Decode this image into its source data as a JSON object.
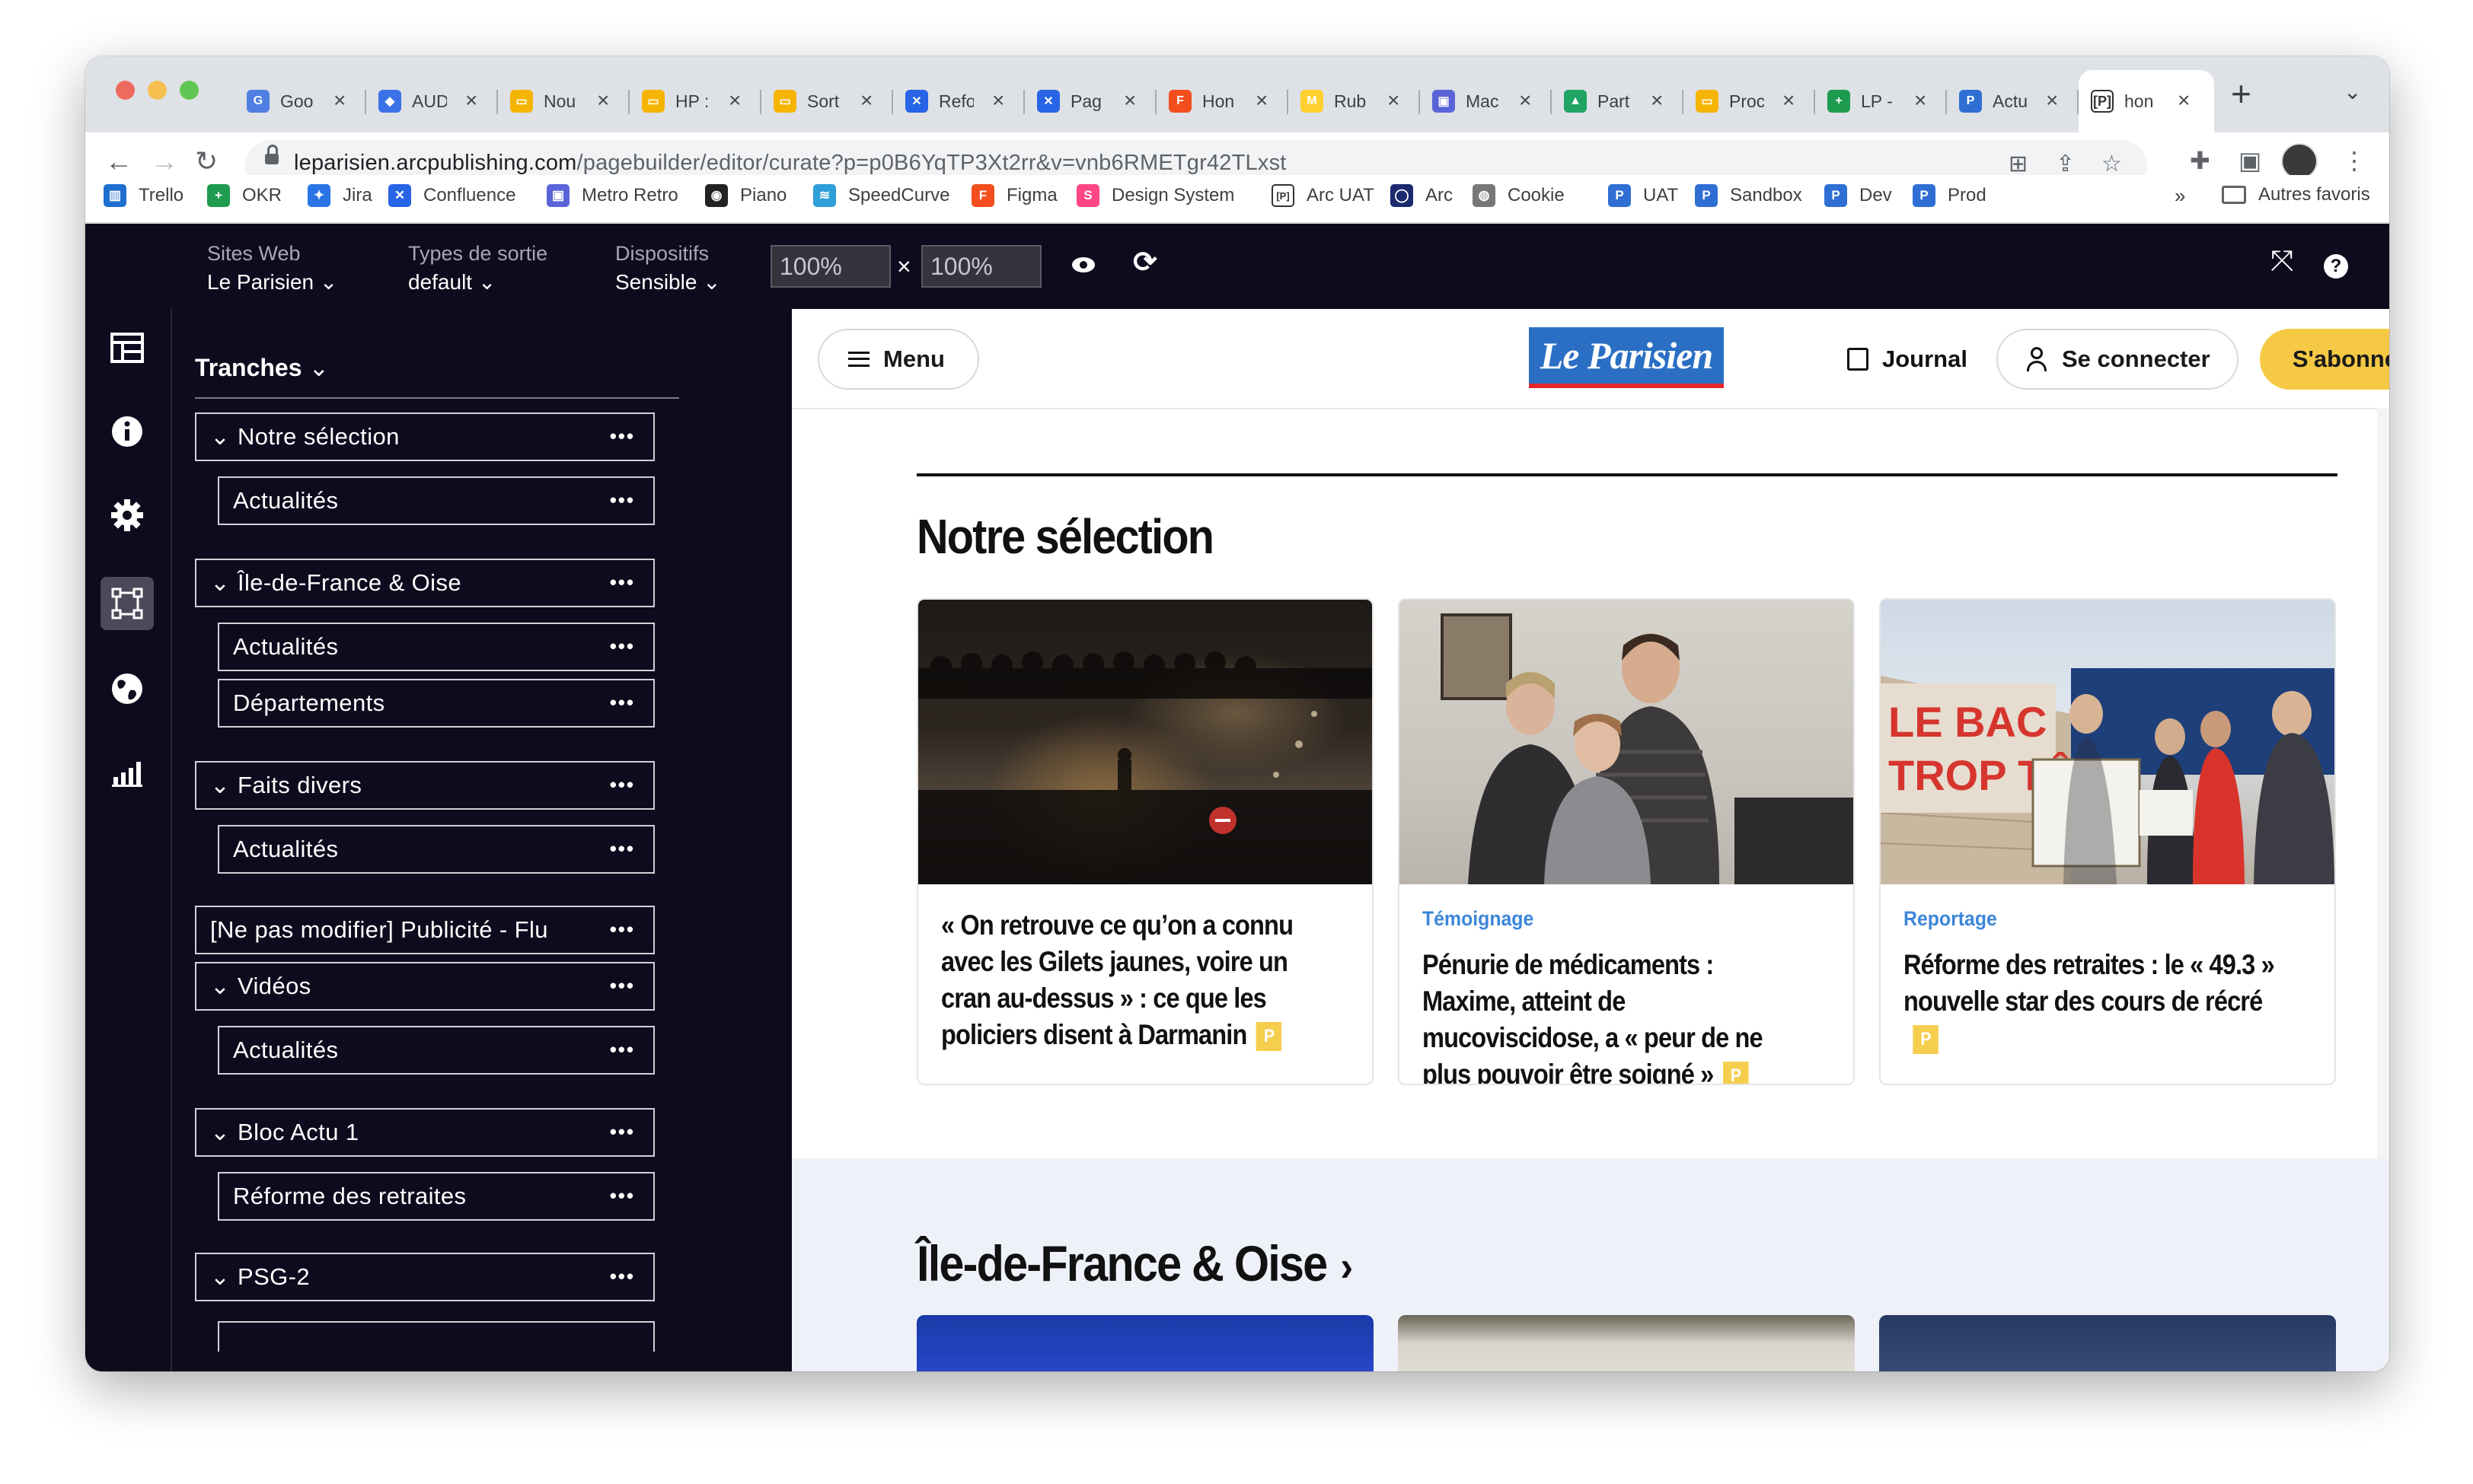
{
  "browser": {
    "traffic_lights": [
      "#ed6a5e",
      "#f4bf4f",
      "#61c554"
    ],
    "tabs": [
      {
        "title": "Goo",
        "icon": "google-docs-icon",
        "color": "#4f7fe0",
        "glyph": "G"
      },
      {
        "title": "AUD",
        "icon": "diamond-icon",
        "color": "#3b72e8",
        "glyph": "◆"
      },
      {
        "title": "Nou",
        "icon": "slides-icon",
        "color": "#f5b400",
        "glyph": "▭"
      },
      {
        "title": "HP :",
        "icon": "slides-icon",
        "color": "#f5b400",
        "glyph": "▭"
      },
      {
        "title": "Sort",
        "icon": "slides-icon",
        "color": "#f5b400",
        "glyph": "▭"
      },
      {
        "title": "Refo",
        "icon": "confluence-icon",
        "color": "#2764e6",
        "glyph": "✕"
      },
      {
        "title": "Pag",
        "icon": "confluence-icon",
        "color": "#2764e6",
        "glyph": "✕"
      },
      {
        "title": "Hon",
        "icon": "figma-icon",
        "color": "#f24e1e",
        "glyph": "F"
      },
      {
        "title": "Rub",
        "icon": "miro-icon",
        "color": "#ffd02f",
        "glyph": "M"
      },
      {
        "title": "Mac",
        "icon": "metro-retro-icon",
        "color": "#5a64d8",
        "glyph": "▣"
      },
      {
        "title": "Part",
        "icon": "google-drive-icon",
        "color": "#1fa463",
        "glyph": "▲"
      },
      {
        "title": "Proc",
        "icon": "slides-icon",
        "color": "#f5b400",
        "glyph": "▭"
      },
      {
        "title": "LP -",
        "icon": "sheets-icon",
        "color": "#1e9b4f",
        "glyph": "+"
      },
      {
        "title": "Actu",
        "icon": "p-icon",
        "color": "#2f6fd4",
        "glyph": "P"
      },
      {
        "title": "hon",
        "icon": "pb-icon",
        "color": "#555555",
        "glyph": "[P]"
      }
    ],
    "new_tab": "+",
    "tab_menu": "⌄",
    "url": {
      "host": "leparisien.arcpublishing.com",
      "path": "/pagebuilder/editor/curate?p=p0B6YqTP3Xt2rr&v=vnb6RMETgr42TLxst"
    },
    "bookmarks": [
      {
        "label": "Trello",
        "icon": "trello-icon",
        "color": "#1f6fd0",
        "glyph": "▥"
      },
      {
        "label": "OKR",
        "icon": "sheets-icon",
        "color": "#1e9b4f",
        "glyph": "+"
      },
      {
        "label": "Jira",
        "icon": "jira-icon",
        "color": "#2a74e6",
        "glyph": "✦"
      },
      {
        "label": "Confluence",
        "icon": "confluence-icon",
        "color": "#2764e6",
        "glyph": "✕"
      },
      {
        "label": "Metro Retro",
        "icon": "metro-retro-icon",
        "color": "#5a64d8",
        "glyph": "▣"
      },
      {
        "label": "Piano",
        "icon": "piano-icon",
        "color": "#222222",
        "glyph": "◉"
      },
      {
        "label": "SpeedCurve",
        "icon": "speedcurve-icon",
        "color": "#2e9fd8",
        "glyph": "≋"
      },
      {
        "label": "Figma",
        "icon": "figma-icon",
        "color": "#f24e1e",
        "glyph": "F"
      },
      {
        "label": "Design System",
        "icon": "storybook-icon",
        "color": "#ff4785",
        "glyph": "S"
      },
      {
        "label": "Arc UAT",
        "icon": "pb-icon",
        "color": "#555555",
        "glyph": "[P]"
      },
      {
        "label": "Arc",
        "icon": "arc-icon",
        "color": "#1b2a6e",
        "glyph": "◯"
      },
      {
        "label": "Cookie",
        "icon": "globe-icon",
        "color": "#777777",
        "glyph": "◍"
      },
      {
        "label": "UAT",
        "icon": "p-icon",
        "color": "#2f6fd4",
        "glyph": "P"
      },
      {
        "label": "Sandbox",
        "icon": "p-icon",
        "color": "#2f6fd4",
        "glyph": "P"
      },
      {
        "label": "Dev",
        "icon": "p-icon",
        "color": "#2f6fd4",
        "glyph": "P"
      },
      {
        "label": "Prod",
        "icon": "p-icon",
        "color": "#2f6fd4",
        "glyph": "P"
      }
    ],
    "bookmarks_overflow": "»",
    "other_bookmarks": "Autres favoris"
  },
  "editor": {
    "sites_label": "Sites Web",
    "sites_value": "Le Parisien",
    "output_label": "Types de sortie",
    "output_value": "default",
    "devices_label": "Dispositifs",
    "devices_value": "Sensible",
    "width_value": "100%",
    "times": "×",
    "height_value": "100%"
  },
  "panel": {
    "title": "Tranches",
    "items": [
      {
        "label": "Notre sélection",
        "more": "•••"
      },
      {
        "label": "Actualités",
        "more": "•••"
      },
      {
        "label": "Île-de-France & Oise",
        "more": "•••"
      },
      {
        "label": "Actualités",
        "more": "•••"
      },
      {
        "label": "Départements",
        "more": "•••"
      },
      {
        "label": "Faits divers",
        "more": "•••"
      },
      {
        "label": "Actualités",
        "more": "•••"
      },
      {
        "label": "[Ne pas modifier] Publicité - Flu",
        "more": "•••"
      },
      {
        "label": "Vidéos",
        "more": "•••"
      },
      {
        "label": "Actualités",
        "more": "•••"
      },
      {
        "label": "Bloc Actu 1",
        "more": "•••"
      },
      {
        "label": "Réforme des retraites",
        "more": "•••"
      },
      {
        "label": "PSG-2",
        "more": "•••"
      }
    ]
  },
  "site": {
    "menu": "Menu",
    "logo": "Le Parisien",
    "journal": "Journal",
    "login": "Se connecter",
    "subscribe": "S'abonner",
    "brand_yellow": "#f6c945",
    "brand_blue": "#2a6fc4",
    "section1": "Notre sélection",
    "cards": [
      {
        "kicker": "",
        "title": "« On retrouve ce qu’on a connu avec les Gilets jaunes, voire un cran au-dessus » : ce que les policiers disent à Darmanin",
        "badge": "P"
      },
      {
        "kicker": "Témoignage",
        "title": "Pénurie de médicaments : Maxime, atteint de mucoviscidose, a « peur de ne plus pouvoir être soigné »",
        "badge": "P"
      },
      {
        "kicker": "Reportage",
        "title": "Réforme des retraites : le « 49.3 » nouvelle star des cours de récré",
        "badge": "P"
      }
    ],
    "section2": "Île-de-France & Oise",
    "section2_chevron": "›"
  }
}
